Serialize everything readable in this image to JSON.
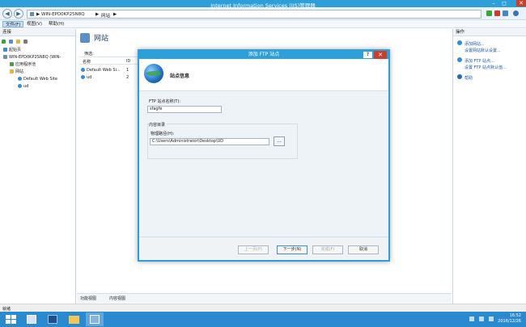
{
  "window": {
    "title": "Internet Information Services (IIS)管理器",
    "min": "–",
    "max": "◻",
    "close": "✕"
  },
  "address": {
    "back": "◀",
    "forward": "▶",
    "crumbs": [
      "WIN-EPD0KP2SN8Q",
      "▶",
      "网站",
      "▶"
    ]
  },
  "menu": [
    "文件(F)",
    "视图(V)",
    "帮助(H)"
  ],
  "left": {
    "header": "连接",
    "tree": [
      "起始页",
      "WIN-EPD0KP2SN8Q (WIN-",
      "应用程序池",
      "网站",
      "Default Web Site",
      "ud"
    ]
  },
  "center": {
    "title": "网站",
    "filter": "筛选:",
    "columns": [
      "名称",
      "ID"
    ],
    "rows": [
      {
        "name": "Default Web Si...",
        "id": "1"
      },
      {
        "name": "ud",
        "id": "2"
      }
    ],
    "tabs": [
      "功能视图",
      "内容视图"
    ]
  },
  "right": {
    "header": "操作",
    "actions": [
      "添加网站...",
      "设置网站默认设置...",
      "添加 FTP 站点...",
      "设置 FTP 站点默认值...",
      "帮助"
    ]
  },
  "status": "就绪",
  "clock": {
    "time": "16:52",
    "date": "2016/12/26"
  },
  "dialog": {
    "title": "添加 FTP 站点",
    "help": "?",
    "close": "✕",
    "heading": "站点信息",
    "site_name_label": "FTP 站点名称(T):",
    "site_name_value": "sfagfe",
    "content_dir_label": "内容目录",
    "path_label": "物理路径(H):",
    "path_value": "C:\\Users\\Administrator\\Desktop\\UD",
    "browse": "...",
    "buttons": {
      "prev": "上一页(P)",
      "next": "下一步(N)",
      "finish": "完成(F)",
      "cancel": "取消"
    }
  },
  "colors": {
    "accent": "#2da0db",
    "taskbar": "#2a8ad0",
    "close": "#c7402e"
  }
}
